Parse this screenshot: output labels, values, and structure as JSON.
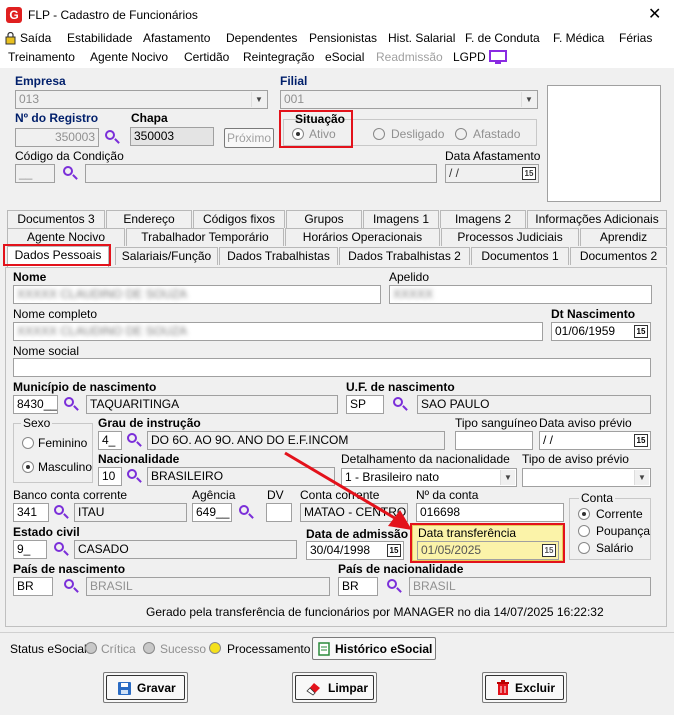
{
  "window": {
    "title": "FLP - Cadastro de Funcionários",
    "app_icon": "G",
    "close": "✕"
  },
  "menu": {
    "row1": [
      "Saída",
      "Estabilidade",
      "Afastamento",
      "Dependentes",
      "Pensionistas",
      "Hist. Salarial",
      "F. de Conduta",
      "F. Médica",
      "Férias"
    ],
    "row2": [
      "Treinamento",
      "Agente Nocivo",
      "Certidão",
      "Reintegração",
      "eSocial",
      "Readmissão",
      "LGPD"
    ]
  },
  "header": {
    "empresa_label": "Empresa",
    "empresa_value": "013",
    "filial_label": "Filial",
    "filial_value": "001",
    "registro_label": "Nº do Registro",
    "registro_value": "350003",
    "chapa_label": "Chapa",
    "chapa_value": "350003",
    "proximo_label": "Próximo",
    "situacao_label": "Situação",
    "situacao_options": [
      "Ativo",
      "Desligado",
      "Afastado"
    ],
    "codigo_condicao_label": "Código da Condição",
    "codigo_condicao_value": "__",
    "data_afastamento_label": "Data Afastamento",
    "data_afastamento_value": "/ /"
  },
  "tabs": {
    "row1": [
      "Documentos 3",
      "Endereço",
      "Códigos fixos",
      "Grupos",
      "Imagens 1",
      "Imagens 2",
      "Informações Adicionais"
    ],
    "row2": [
      "Agente Nocivo",
      "Trabalhador Temporário",
      "Horários Operacionais",
      "Processos Judiciais",
      "Aprendiz"
    ],
    "row3": [
      "Dados Pessoais",
      "Salariais/Função",
      "Dados Trabalhistas",
      "Dados Trabalhistas 2",
      "Documentos 1",
      "Documentos 2"
    ]
  },
  "form": {
    "nome_label": "Nome",
    "nome_value": "XXXXX CLAUDINO DE SOUZA",
    "apelido_label": "Apelido",
    "apelido_value": "XXXXX",
    "nome_completo_label": "Nome completo",
    "nome_completo_value": "XXXXX CLAUDINO DE SOUZA",
    "dt_nascimento_label": "Dt Nascimento",
    "dt_nascimento_value": "01/06/1959",
    "nome_social_label": "Nome social",
    "nome_social_value": "",
    "municipio_label": "Município de nascimento",
    "municipio_code": "8430__",
    "municipio_value": "TAQUARITINGA",
    "uf_label": "U.F. de nascimento",
    "uf_code": "SP",
    "uf_value": "SAO PAULO",
    "sexo_label": "Sexo",
    "sexo_options": [
      "Feminino",
      "Masculino"
    ],
    "grau_label": "Grau de instrução",
    "grau_code": "4_",
    "grau_value": "DO 6O. AO 9O. ANO DO E.F.INCOM",
    "tipo_sanguineo_label": "Tipo sanguíneo",
    "tipo_sanguineo_value": "",
    "data_aviso_label": "Data aviso prévio",
    "data_aviso_value": "/ /",
    "nacionalidade_label": "Nacionalidade",
    "nacionalidade_code": "10",
    "nacionalidade_value": "BRASILEIRO",
    "detalhamento_label": "Detalhamento da nacionalidade",
    "detalhamento_value": "1 - Brasileiro nato",
    "tipo_aviso_label": "Tipo de aviso prévio",
    "tipo_aviso_value": "",
    "banco_label": "Banco conta corrente",
    "banco_code": "341",
    "banco_value": "ITAU",
    "agencia_label": "Agência",
    "agencia_value": "649__",
    "dv_label": "DV",
    "dv_value": "",
    "conta_corrente_label": "Conta corrente",
    "conta_corrente_value": "MATAO - CENTRO",
    "n_conta_label": "Nº da conta",
    "n_conta_value": "016698",
    "conta_label": "Conta",
    "conta_options": [
      "Corrente",
      "Poupança",
      "Salário"
    ],
    "estado_civil_label": "Estado civil",
    "estado_civil_code": "9_",
    "estado_civil_value": "CASADO",
    "data_admissao_label": "Data de admissão",
    "data_admissao_value": "30/04/1998",
    "data_transferencia_label": "Data transferência",
    "data_transferencia_value": "01/05/2025",
    "pais_nasc_label": "País de nascimento",
    "pais_nasc_code": "BR",
    "pais_nasc_value": "BRASIL",
    "pais_nac_label": "País de nacionalidade",
    "pais_nac_code": "BR",
    "pais_nac_value": "BRASIL",
    "footer_note": "Gerado pela transferência de funcionários por MANAGER no dia 14/07/2025 16:22:32",
    "calendar_glyph": "15"
  },
  "status": {
    "label": "Status eSocial:",
    "items": [
      {
        "name": "Crítica",
        "color": "#c8c8c8"
      },
      {
        "name": "Sucesso",
        "color": "#c8c8c8"
      },
      {
        "name": "Processamento",
        "color": "#f5e11a"
      }
    ],
    "historico_label": "Histórico eSocial"
  },
  "buttons": {
    "gravar": "Gravar",
    "limpar": "Limpar",
    "excluir": "Excluir"
  },
  "colors": {
    "accent_red": "#e3121b",
    "highlight_yellow": "#fbf3a9",
    "lupa_purple": "#7b2fd9"
  }
}
